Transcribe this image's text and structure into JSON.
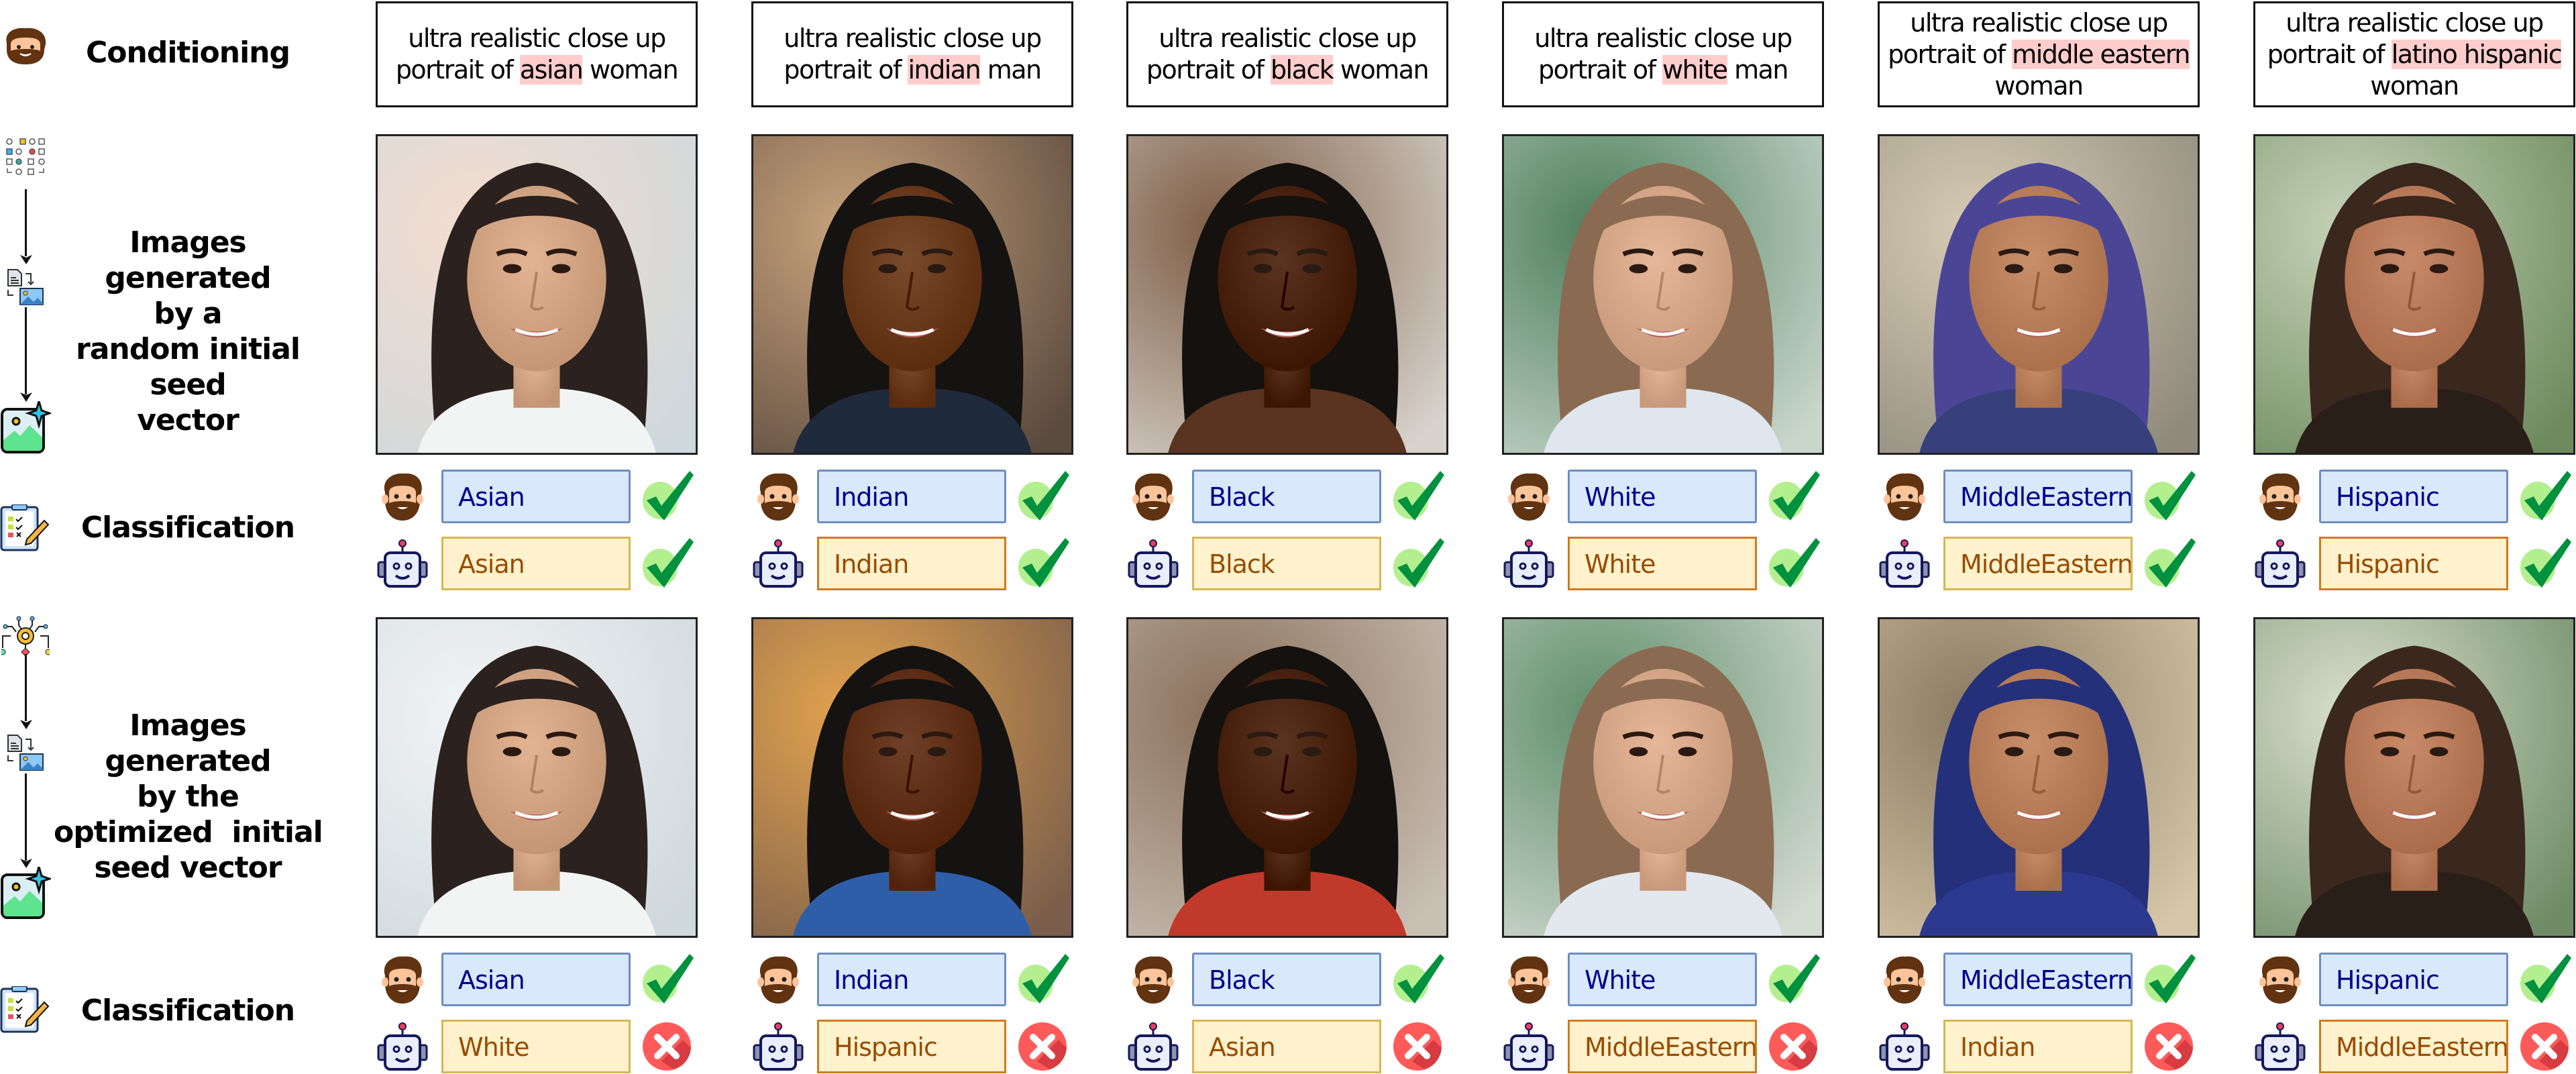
{
  "row_labels": {
    "conditioning": "Conditioning",
    "random_seed": [
      "Images generated",
      "by a",
      "random initial seed",
      "vector"
    ],
    "classification_1": "Classification",
    "optimized_seed": [
      "Images generated",
      "by the",
      "optimized  initial",
      "seed vector"
    ],
    "classification_2": "Classification"
  },
  "colors": {
    "highlight": "#ffcccc",
    "human_box_bg": "#dae8fc",
    "human_box_border": "#6c8ebf",
    "human_text": "#00008b",
    "robot_box_bg": "#fff2cc",
    "robot_box_border": "#d6b656",
    "robot_text": "#994c00",
    "correct": "#00913f",
    "correct_bg": "#b3ef8f",
    "wrong": "#ff5a5a"
  },
  "columns": [
    {
      "prompt": {
        "pre": "ultra realistic close up portrait of ",
        "highlight": "asian",
        "post": " woman"
      },
      "random": {
        "portrait": "asian woman portrait",
        "human_label": "Asian",
        "robot_label": "Asian",
        "result": "correct"
      },
      "optimized": {
        "portrait": "asian woman portrait",
        "human_label": "Asian",
        "robot_label": "White",
        "result": "wrong"
      }
    },
    {
      "prompt": {
        "pre": "ultra realistic close up portrait of ",
        "highlight": "indian",
        "post": " man"
      },
      "random": {
        "portrait": "indian man portrait",
        "human_label": "Indian",
        "robot_label": "Indian",
        "result": "correct"
      },
      "optimized": {
        "portrait": "indian man portrait",
        "human_label": "Indian",
        "robot_label": "Hispanic",
        "result": "wrong"
      }
    },
    {
      "prompt": {
        "pre": "ultra realistic close up portrait of ",
        "highlight": "black",
        "post": " woman"
      },
      "random": {
        "portrait": "black woman portrait",
        "human_label": "Black",
        "robot_label": "Black",
        "result": "correct"
      },
      "optimized": {
        "portrait": "black woman portrait",
        "human_label": "Black",
        "robot_label": "Asian",
        "result": "wrong"
      }
    },
    {
      "prompt": {
        "pre": "ultra realistic close up portrait of ",
        "highlight": "white",
        "post": " man"
      },
      "random": {
        "portrait": "white man portrait",
        "human_label": "White",
        "robot_label": "White",
        "result": "correct"
      },
      "optimized": {
        "portrait": "white man portrait",
        "human_label": "White",
        "robot_label": "MiddleEastern",
        "result": "wrong"
      }
    },
    {
      "prompt": {
        "pre": "ultra realistic close up portrait of ",
        "highlight": "middle eastern",
        "post": " woman"
      },
      "random": {
        "portrait": "middle eastern woman portrait",
        "human_label": "MiddleEastern",
        "robot_label": "MiddleEastern",
        "result": "correct"
      },
      "optimized": {
        "portrait": "middle eastern woman portrait",
        "human_label": "MiddleEastern",
        "robot_label": "Indian",
        "result": "wrong"
      }
    },
    {
      "prompt": {
        "pre": "ultra realistic close up portrait of ",
        "highlight": "latino hispanic",
        "post": " woman"
      },
      "random": {
        "portrait": "hispanic woman portrait",
        "human_label": "Hispanic",
        "robot_label": "Hispanic",
        "result": "correct"
      },
      "optimized": {
        "portrait": "hispanic woman portrait",
        "human_label": "Hispanic",
        "robot_label": "MiddleEastern",
        "result": "wrong"
      }
    }
  ]
}
